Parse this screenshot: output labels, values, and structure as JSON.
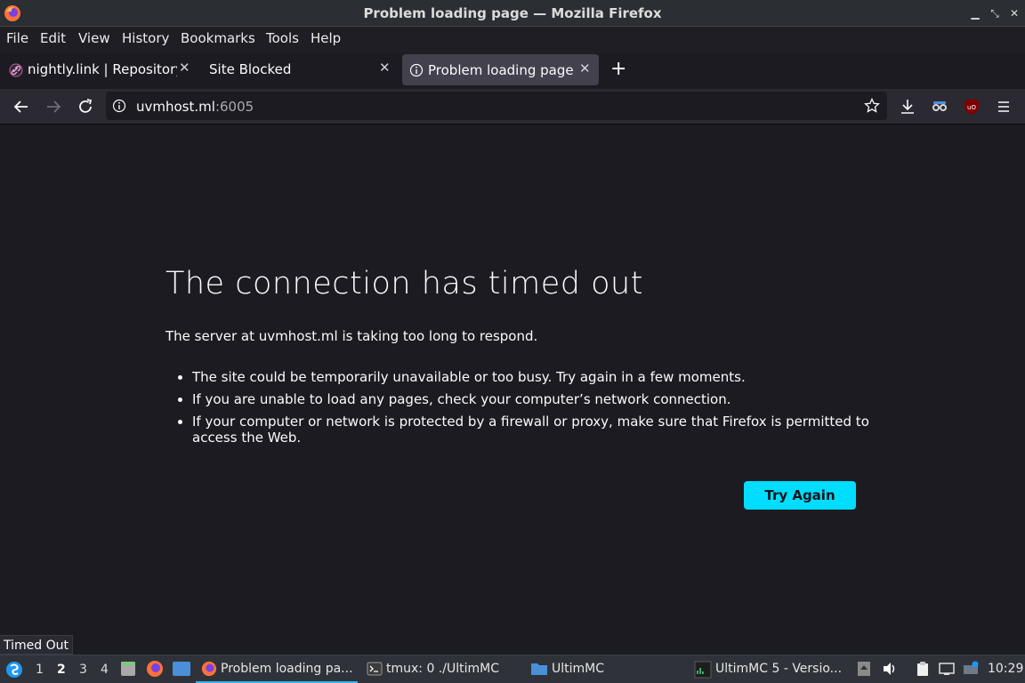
{
  "window": {
    "title": "Problem loading page — Mozilla Firefox",
    "controls": [
      "minimize-icon",
      "maximize-icon",
      "close-icon"
    ]
  },
  "menu": {
    "items": [
      "File",
      "Edit",
      "View",
      "History",
      "Bookmarks",
      "Tools",
      "Help"
    ]
  },
  "tabs": [
    {
      "label": "nightly.link | Repository",
      "icon": "link-icon",
      "active": false
    },
    {
      "label": "Site Blocked",
      "icon": "",
      "active": false
    },
    {
      "label": "Problem loading page",
      "icon": "info-icon",
      "active": true
    }
  ],
  "new_tab": "+",
  "urlbar": {
    "host": "uvmhost.ml",
    "port": ":6005"
  },
  "error": {
    "title": "The connection has timed out",
    "description": "The server at uvmhost.ml is taking too long to respond.",
    "bullets": [
      "The site could be temporarily unavailable or too busy. Try again in a few moments.",
      "If you are unable to load any pages, check your computer’s network connection.",
      "If your computer or network is protected by a firewall or proxy, make sure that Firefox is permitted to access the Web."
    ],
    "button": "Try Again"
  },
  "status_tooltip": "Timed Out",
  "taskbar": {
    "workspaces": [
      "1",
      "2",
      "3",
      "4"
    ],
    "current_workspace": "2",
    "tasks": [
      {
        "label": "Problem loading pa...",
        "icon": "firefox-icon"
      },
      {
        "label": "tmux: 0 ./UltimMC",
        "icon": "terminal-icon"
      },
      {
        "label": "UltimMC",
        "icon": "folder-icon"
      },
      {
        "label": "UltimMC 5 - Versio...",
        "icon": "app-icon"
      }
    ],
    "clock": "10:29"
  },
  "colors": {
    "accent_button": "#00ddff",
    "page_bg": "#1c1b22",
    "toolbar_bg": "#2b2a33",
    "taskbar_bg": "#2f3339"
  }
}
